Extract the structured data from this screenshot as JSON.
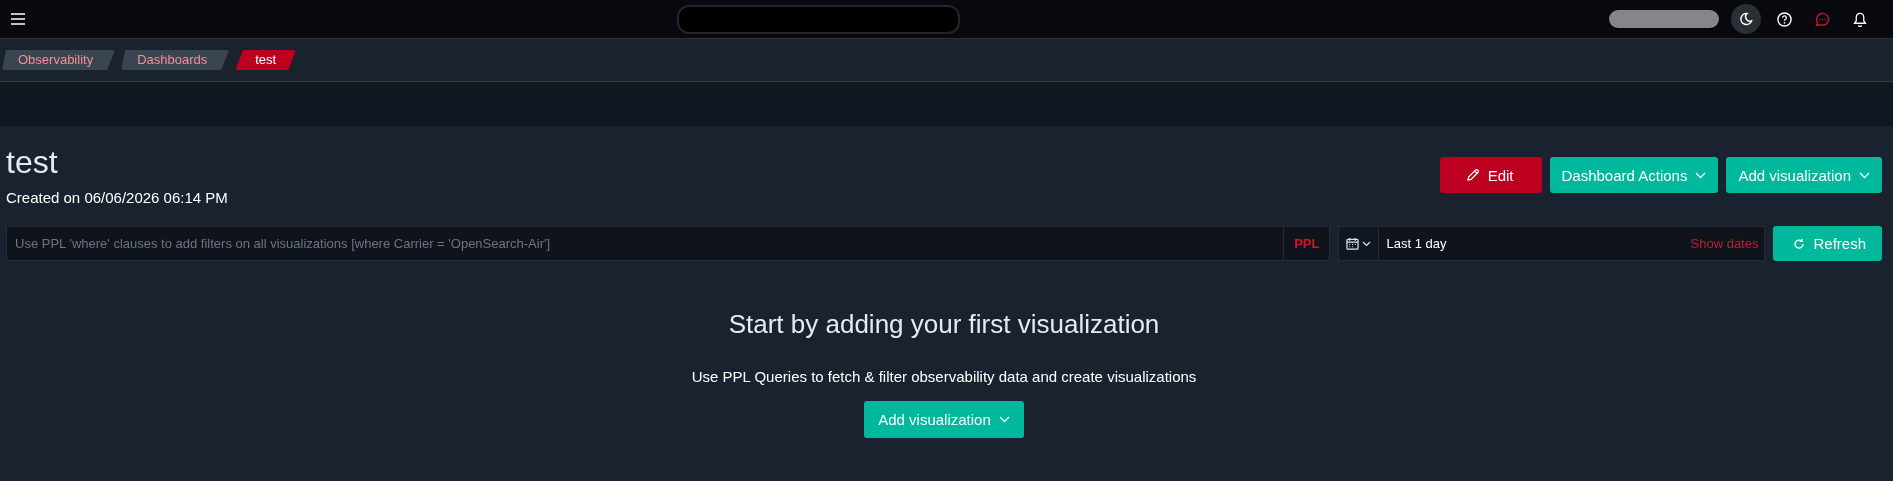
{
  "breadcrumbs": [
    {
      "label": "Observability",
      "selected": false
    },
    {
      "label": "Dashboards",
      "selected": false
    },
    {
      "label": "test",
      "selected": true
    }
  ],
  "page": {
    "title": "test",
    "created": "Created on 06/06/2026 06:14 PM"
  },
  "actions": [
    {
      "label": "Edit",
      "kind": "edit"
    },
    {
      "label": "Dashboard Actions",
      "kind": "menu"
    },
    {
      "label": "Add visualization",
      "kind": "menu"
    }
  ],
  "filter": {
    "placeholder": "Use PPL 'where' clauses to add filters on all visualizations [where Carrier = 'OpenSearch-Air']",
    "language": "PPL"
  },
  "time": {
    "range": "Last 1 day",
    "toggle": "Show dates"
  },
  "refresh": {
    "label": "Refresh"
  },
  "empty_state": {
    "title": "Start by adding your first visualization",
    "body": "Use PPL Queries to fetch & filter observability data and create visualizations",
    "button": "Add visualization"
  }
}
